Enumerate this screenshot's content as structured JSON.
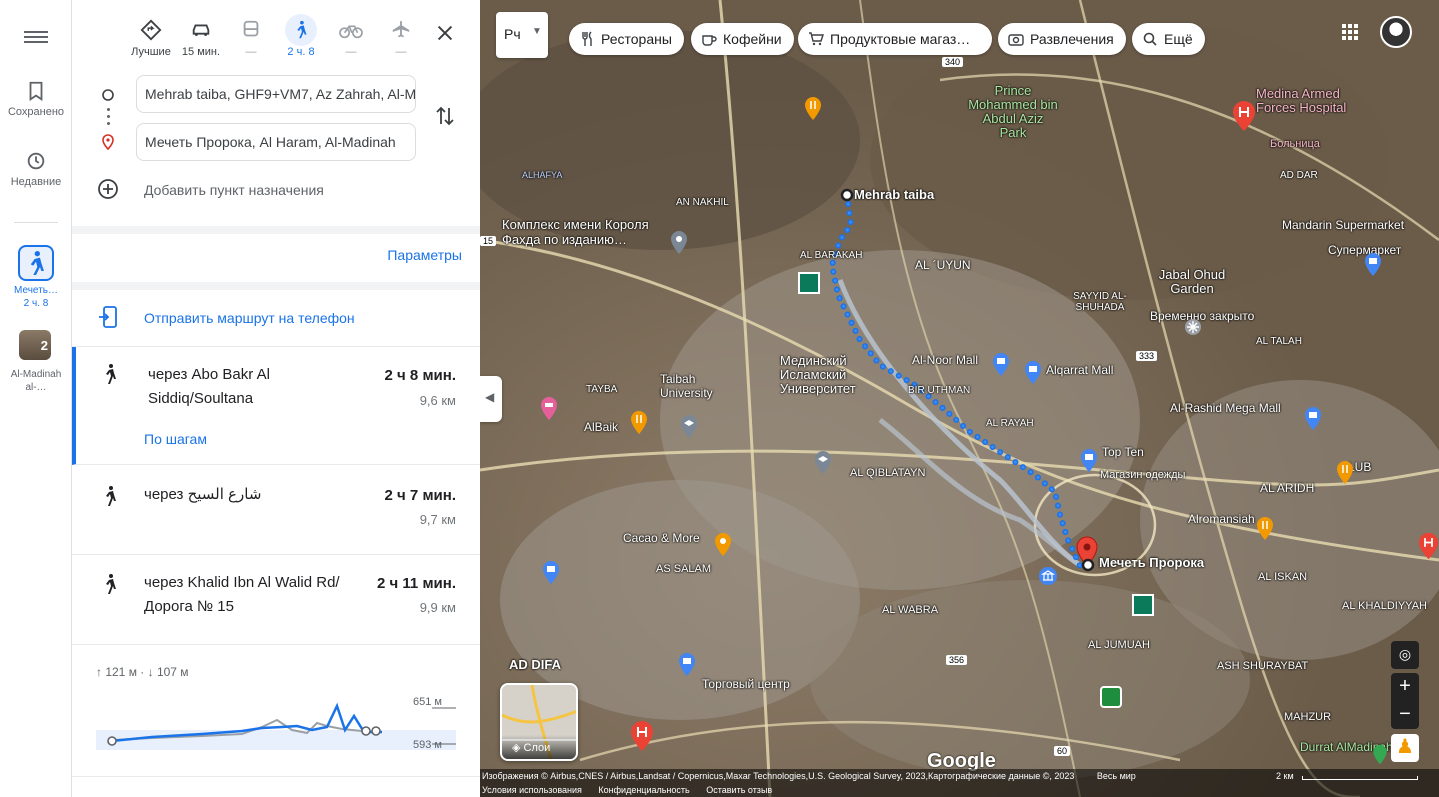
{
  "rail": {
    "saved_label": "Сохранено",
    "recent_label": "Недавние",
    "active_trip": {
      "line1": "Мечеть…",
      "line2": "2 ч. 8"
    },
    "history_trip": {
      "badge": "2",
      "line1": "Al-Madinah",
      "line2": "al-…"
    }
  },
  "modes": [
    {
      "name": "best",
      "label": "Лучшие"
    },
    {
      "name": "car",
      "label": "15 мин."
    },
    {
      "name": "transit",
      "label": "—"
    },
    {
      "name": "walk",
      "label": "2 ч. 8"
    },
    {
      "name": "bike",
      "label": "—"
    },
    {
      "name": "flight",
      "label": "—"
    }
  ],
  "inputs": {
    "origin": "Mehrab taiba, GHF9+VM7, Az Zahrah, Al-M",
    "destination": "Мечеть Пророка, Al Haram, Al-Madinah"
  },
  "add_destination": "Добавить пункт назначения",
  "params_link": "Параметры",
  "send_to_phone": "Отправить маршрут на телефон",
  "routes": [
    {
      "title": "через Abo Bakr Al Siddiq/Soultana",
      "duration": "2 ч 8 мин.",
      "distance": "9,6 км",
      "steps": "По шагам"
    },
    {
      "title": "через شارع السيح",
      "duration": "2 ч 7 мин.",
      "distance": "9,7 км"
    },
    {
      "title": "через Khalid Ibn Al Walid Rd/ Дорога № 15",
      "duration": "2 ч 11 мин.",
      "distance": "9,9 км"
    }
  ],
  "elevation": {
    "summary": "↑ 121 м · ↓ 107 м",
    "max": "651 м",
    "min": "593 м"
  },
  "map": {
    "selector": "Рч",
    "chips": [
      "Рестораны",
      "Кофейни",
      "Продуктовые магаз…",
      "Развлечения",
      "Ещё"
    ],
    "origin_label": "Mehrab taiba",
    "destination_label": "Мечеть Пророка",
    "labels": [
      {
        "text": "Prince Mohammed bin Abdul Aziz Park",
        "cls": "green"
      },
      {
        "text": "Medina Armed Forces Hospital",
        "cls": "pink"
      },
      {
        "text": "Mandarin Supermarket",
        "cls": ""
      },
      {
        "text": "Супермаркет",
        "cls": ""
      },
      {
        "text": "Jabal Ohud Garden",
        "cls": ""
      },
      {
        "text": "Временно закрыто",
        "cls": ""
      },
      {
        "text": "Комплекс имени Короля Фахда по изданию…",
        "cls": "big"
      },
      {
        "text": "AL ´UYUN",
        "cls": ""
      },
      {
        "text": "Al-Noor Mall",
        "cls": ""
      },
      {
        "text": "Alqarrat Mall",
        "cls": ""
      },
      {
        "text": "Al-Rashid Mega Mall",
        "cls": ""
      },
      {
        "text": "Мединский Исламский Университет",
        "cls": "big"
      },
      {
        "text": "Taibah University",
        "cls": ""
      },
      {
        "text": "AlBaik",
        "cls": ""
      },
      {
        "text": "Top Ten",
        "cls": ""
      },
      {
        "text": "Магазин одежды",
        "cls": ""
      },
      {
        "text": "AL ARIDH",
        "cls": ""
      },
      {
        "text": "LUB",
        "cls": ""
      },
      {
        "text": "Cacao & More",
        "cls": ""
      },
      {
        "text": "Alromansiah",
        "cls": ""
      },
      {
        "text": "AL QIBLATAYN",
        "cls": ""
      },
      {
        "text": "AS SALAM",
        "cls": ""
      },
      {
        "text": "AD DIFA",
        "cls": ""
      },
      {
        "text": "Торговый центр",
        "cls": ""
      },
      {
        "text": "AL WABRA",
        "cls": ""
      },
      {
        "text": "AL JUMUAH",
        "cls": ""
      },
      {
        "text": "ASH SHURAYBAT",
        "cls": ""
      },
      {
        "text": "AL ISKAN",
        "cls": ""
      },
      {
        "text": "AL KHALDIYYAH",
        "cls": ""
      },
      {
        "text": "MAHZUR",
        "cls": ""
      },
      {
        "text": "Durrat AlMadinah",
        "cls": "green"
      },
      {
        "text": "Больница",
        "cls": "pink"
      },
      {
        "text": "AL BARAKAH",
        "cls": ""
      },
      {
        "text": "AN NAKHIL",
        "cls": ""
      },
      {
        "text": "SAYYID AL-SHUHADA",
        "cls": ""
      },
      {
        "text": "AL TALAH",
        "cls": ""
      },
      {
        "text": "AD DAR",
        "cls": ""
      },
      {
        "text": "BIR UTHMAN",
        "cls": ""
      },
      {
        "text": "AL RAYAH",
        "cls": ""
      },
      {
        "text": "TAYBA",
        "cls": ""
      },
      {
        "text": "ALHAFYA",
        "cls": ""
      }
    ],
    "roads": [
      "340",
      "15",
      "333",
      "356",
      "60"
    ],
    "layers_label": "Слои",
    "google": "Google",
    "footer": [
      "Изображения © Airbus,CNES / Airbus,Landsat / Copernicus,Maxar Technologies,U.S. Geological Survey, 2023,Картографические данные ©, 2023",
      "Весь мир",
      "Условия использования",
      "Конфиденциальность",
      "Оставить отзыв"
    ],
    "scale": "2 км"
  }
}
